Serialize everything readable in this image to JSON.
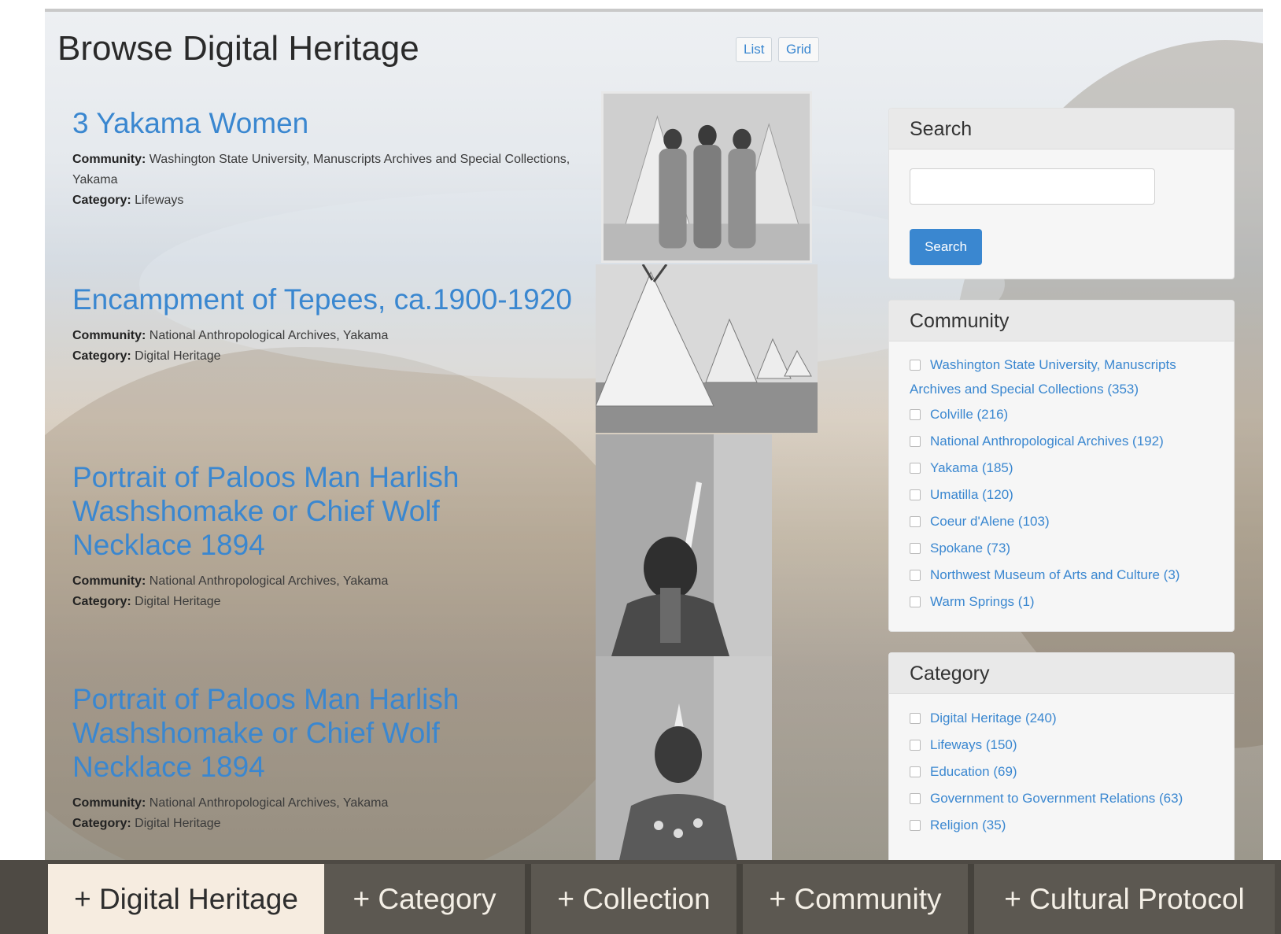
{
  "page": {
    "title": "Browse Digital Heritage",
    "view_toggle": {
      "list_label": "List",
      "grid_label": "Grid"
    }
  },
  "results": [
    {
      "title": "3 Yakama Women",
      "community_label": "Community:",
      "community": "Washington State University, Manuscripts Archives and Special Collections, Yakama",
      "category_label": "Category:",
      "category": "Lifeways"
    },
    {
      "title": "Encampment of Tepees, ca.1900-1920",
      "community_label": "Community:",
      "community": "National Anthropological Archives, Yakama",
      "category_label": "Category:",
      "category": "Digital Heritage"
    },
    {
      "title": "Portrait of Paloos Man Harlish Washshomake or Chief Wolf Necklace 1894",
      "community_label": "Community:",
      "community": "National Anthropological Archives, Yakama",
      "category_label": "Category:",
      "category": "Digital Heritage"
    },
    {
      "title": "Portrait of Paloos Man Harlish Washshomake or Chief Wolf Necklace 1894",
      "community_label": "Community:",
      "community": "National Anthropological Archives, Yakama",
      "category_label": "Category:",
      "category": "Digital Heritage"
    }
  ],
  "sidebar": {
    "search": {
      "heading": "Search",
      "input_value": "",
      "button_label": "Search"
    },
    "community": {
      "heading": "Community",
      "options": [
        "Washington State University, Manuscripts Archives and Special Collections (353)",
        "Colville (216)",
        "National Anthropological Archives (192)",
        "Yakama (185)",
        "Umatilla (120)",
        "Coeur d'Alene (103)",
        "Spokane (73)",
        "Northwest Museum of Arts and Culture (3)",
        "Warm Springs (1)"
      ]
    },
    "category": {
      "heading": "Category",
      "options": [
        "Digital Heritage (240)",
        "Lifeways (150)",
        "Education (69)",
        "Government to Government Relations (63)",
        "Religion (35)"
      ]
    }
  },
  "tabs": [
    {
      "label": "+ Digital Heritage",
      "active": true
    },
    {
      "label": "+ Category",
      "active": false
    },
    {
      "label": "+ Collection",
      "active": false
    },
    {
      "label": "+ Community",
      "active": false
    },
    {
      "label": "+ Cultural Protocol",
      "active": false
    }
  ],
  "colors": {
    "link": "#3a87d0",
    "tabbar": "#4e4a44",
    "tab_active": "#f6ece0"
  }
}
